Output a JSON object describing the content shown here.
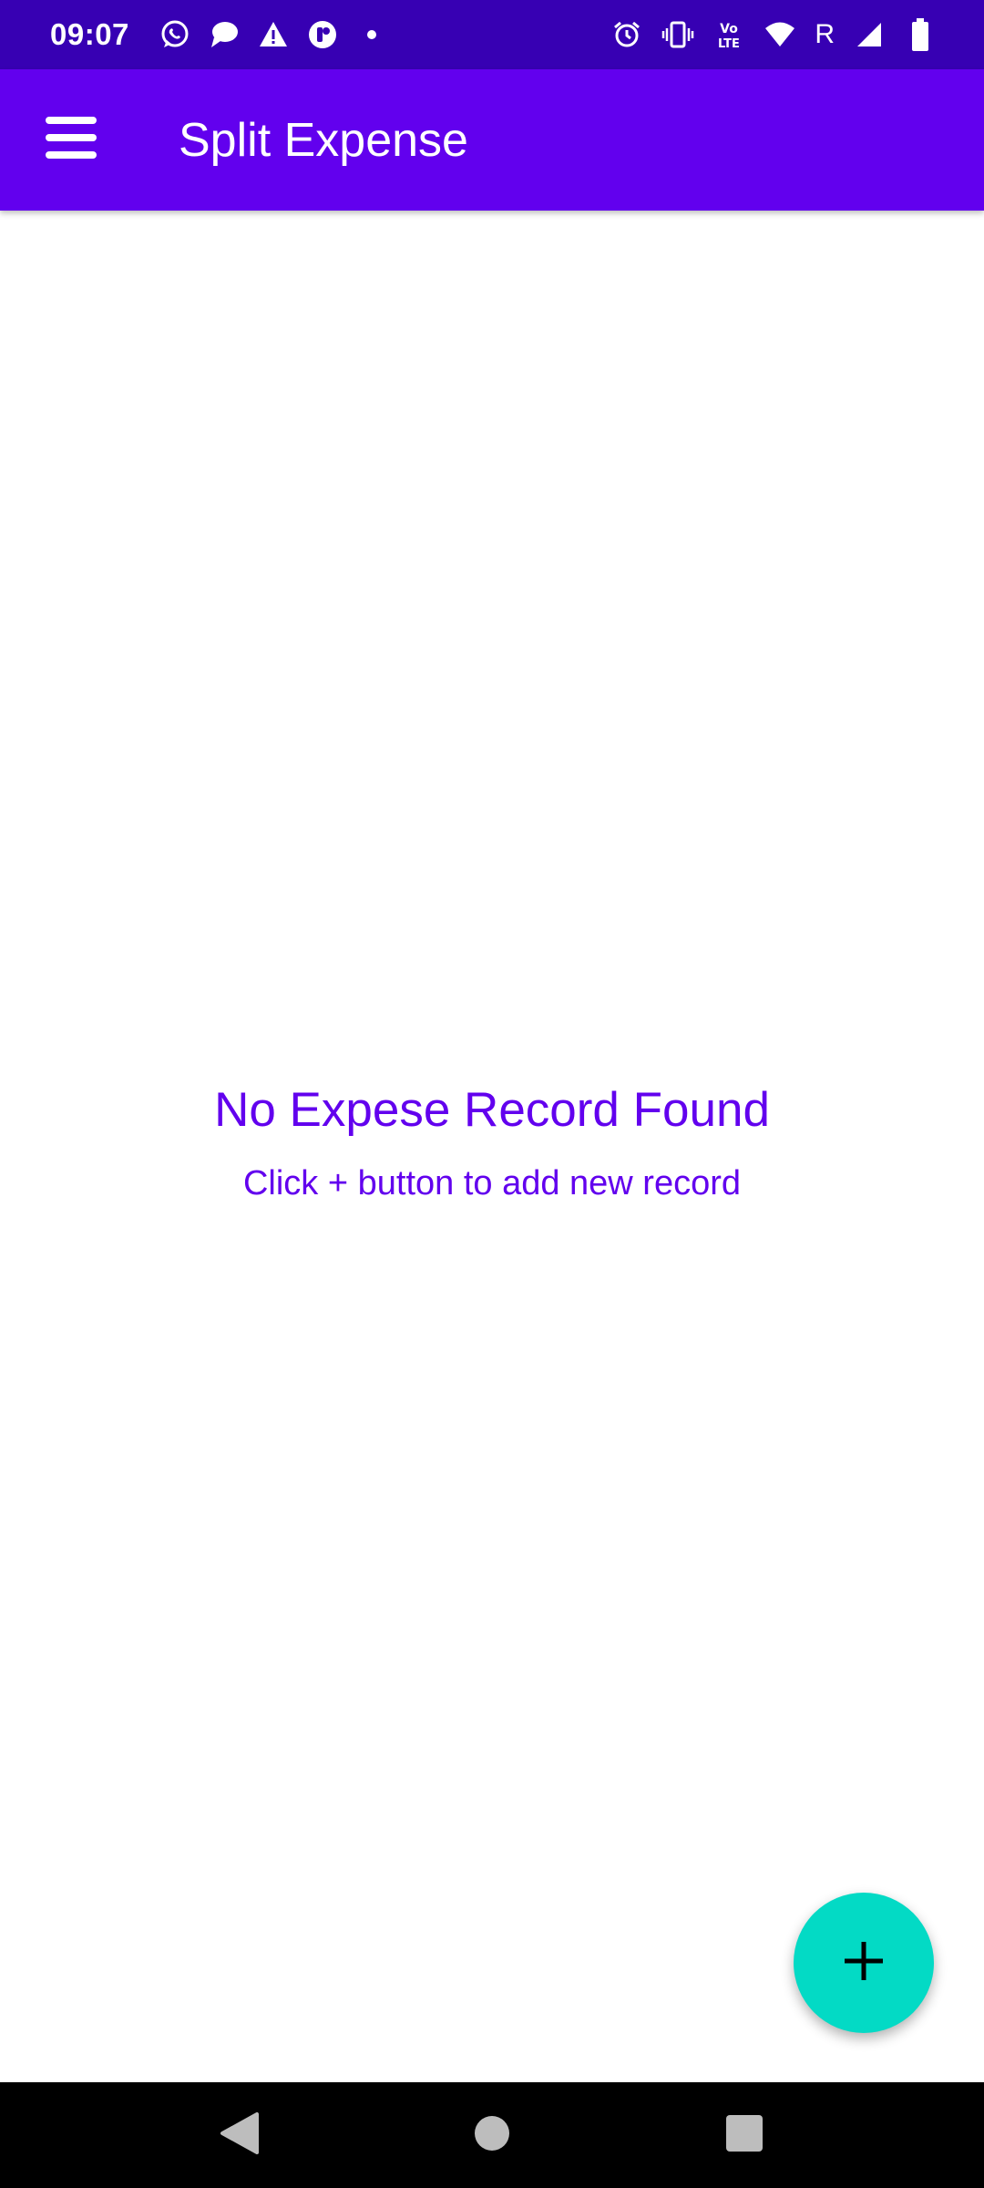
{
  "status_bar": {
    "time": "09:07",
    "left_icons": [
      "whatsapp-icon",
      "message-icon",
      "warning-icon",
      "app-notification-icon",
      "dot-icon"
    ],
    "right_icons": [
      "alarm-icon",
      "vibrate-icon",
      "volte-icon",
      "wifi-icon",
      "roaming-indicator",
      "signal-icon",
      "battery-icon"
    ],
    "roaming_label": "R"
  },
  "app_bar": {
    "title": "Split Expense",
    "color": "#6200ee"
  },
  "empty_state": {
    "title": "No Expese Record Found",
    "subtitle": "Click + button to add new record"
  },
  "fab": {
    "icon": "plus-icon",
    "color": "#03dac5"
  },
  "nav_bar": {
    "buttons": [
      "back-button",
      "home-button",
      "recents-button"
    ]
  }
}
